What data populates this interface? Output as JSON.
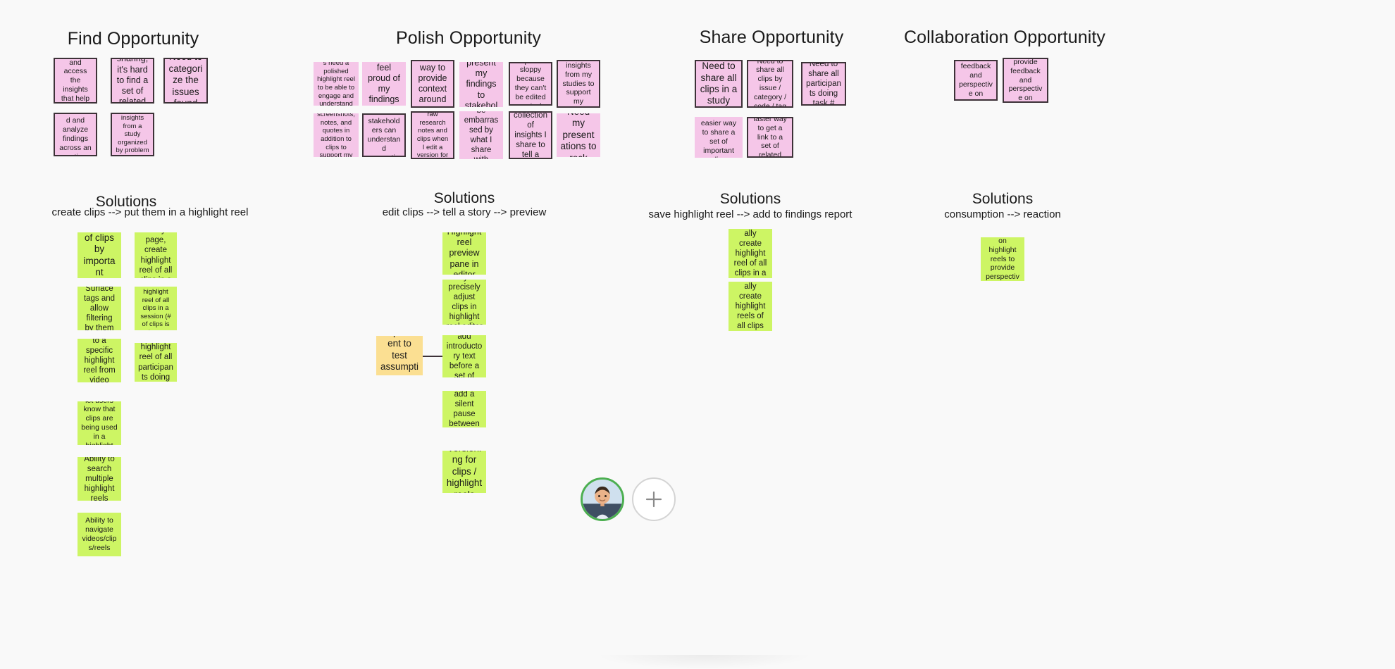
{
  "board": {
    "background_color": "#f9f9f9",
    "note_pink": "#f5c6e8",
    "note_green": "#cdf564",
    "note_yellow": "#fbdf92",
    "note_border": "#3d3238"
  },
  "sections": [
    {
      "title": "Find Opportunity"
    },
    {
      "title": "Polish Opportunity"
    },
    {
      "title": "Share Opportunity"
    },
    {
      "title": "Collaboration Opportunity"
    }
  ],
  "solutions_headings": [
    {
      "title": "Solutions",
      "flow": "create clips   -->   put them in a highlight reel"
    },
    {
      "title": "Solutions",
      "flow": "edit clips   -->   tell a story   -->   preview"
    },
    {
      "title": "Solutions",
      "flow": "save highlight reel   -->   add to findings report"
    },
    {
      "title": "Solutions",
      "flow": "consumption   -->   reaction"
    }
  ],
  "find_notes": [
    "It's hard to find and access the insights that help me tell a story",
    "When sharing, it's hard to find a set of related clips",
    "Need to categorize the issues found",
    "Need to understand and analyze findings across an entire study",
    "Need a way to see insights from a study organized by problem and severity"
  ],
  "polish_notes": [
    "Stakeholders need a polished highlight reel to be able to engage and understand the problem",
    "Need to feel proud of my findings report",
    "Need a way to provide context around insights",
    "Need to present my findings to stakeholders",
    "Clips are sloppy because they can't be edited precisely",
    "Need to assemble insights from my studies to support my conclusions",
    "Presenting screenshots, notes, and quotes in addition to clips to support my conclusion",
    "Need to be sure stakeholders can understand supporting clips",
    "Don't want to lose my raw research notes and clips when I edit a version for stakeholders",
    "Don't want to be embarrassed by what I share with stakeholders",
    "Need the collection of insights I share to tell a story",
    "Need my presentations to rock"
  ],
  "share_notes": [
    "Need to share all clips in a study",
    "Need to share all clips by issue / category / code / tag",
    "Need to share all participants doing task #",
    "Need an easier way to share a set of important clips",
    "Need a faster way to get a link to a set of related clips"
  ],
  "collaboration_notes": [
    "Peers provide feedback and perspective on highlight reels",
    "Stakeholders provide feedback and perspective on highlight reels"
  ],
  "find_solutions": [
    "Filter list of clips by important criteria",
    "From study page, create highlight reel of all clips in a study",
    "Surface tags and allow filtering by them",
    "From study page, create highlight reel of all clips in a session (# of clips is shown; could be link)",
    "Add a clip to a specific highlight reel from video player",
    "Create a highlight reel of all participants doing \"task 2\"",
    "Indicator to let users know that clips are being used in a highlight reel",
    "Ability to search multiple highlight reels",
    "Ability to navigate videos/clips/reels"
  ],
  "polish_solutions": [
    "Highlight reel preview pane in editor",
    "Way to precisely adjust clips in highlight reel editor",
    "Ability to add introductory text before a set of clips",
    "Ability to add a silent pause between clips",
    "Versioning for clips / highlight reels"
  ],
  "polish_experiment": "Experiment to test assumption",
  "share_solutions": [
    "Automatically create highlight reel of all clips in a study",
    "Automatically create highlight reels of all clips by tag"
  ],
  "collaboration_solutions": [
    "Allow comments on highlight reels to provide perspective and context"
  ],
  "toolbar": {
    "avatar_label": "user-avatar",
    "add_label": "+"
  }
}
